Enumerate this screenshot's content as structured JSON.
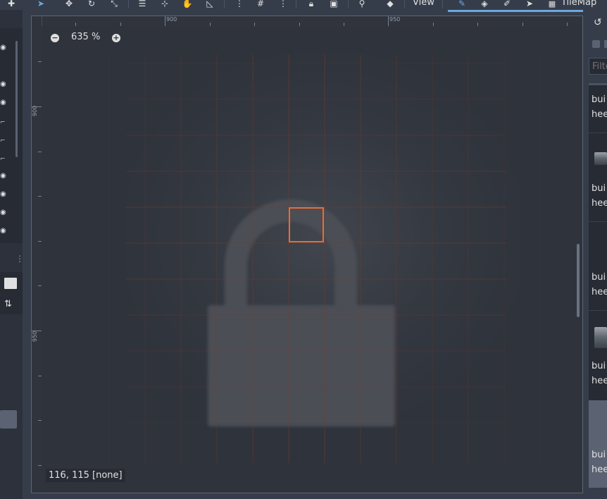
{
  "toolbar": {
    "view_label": "View",
    "tilemap_label": "TileMap",
    "tools": [
      "select-icon",
      "move-icon",
      "rotate-icon",
      "scale-icon",
      "list-select-icon",
      "ruler-pointer-icon",
      "pan-icon",
      "ruler-icon",
      "smart-snap-icon",
      "grid-snap-icon",
      "more-icon",
      "lock-icon",
      "group-icon",
      "bone-icon",
      "view-camera-icon"
    ],
    "tilemap_tools": [
      "pencil-icon",
      "bucket-fill-icon",
      "picker-icon",
      "select-icon"
    ]
  },
  "viewport": {
    "zoom_label": "635 %",
    "coords_label": "116, 115 [none]",
    "ruler_top_labels": [
      "900",
      "950"
    ],
    "ruler_left_labels": [
      "900",
      "950"
    ]
  },
  "right_panel": {
    "filter_placeholder": "Filter",
    "tiles": [
      {
        "line1": "bui",
        "line2": "hee"
      },
      {
        "line1": "bui",
        "line2": "hee"
      },
      {
        "line1": "bui",
        "line2": "hee"
      },
      {
        "line1": "bui",
        "line2": "hee"
      },
      {
        "line1": "bui",
        "line2": "hee"
      }
    ]
  },
  "colors": {
    "accent": "#6aa9e0",
    "cursor_cell": "#e56e38",
    "grid_line": "#7a3b2c"
  }
}
